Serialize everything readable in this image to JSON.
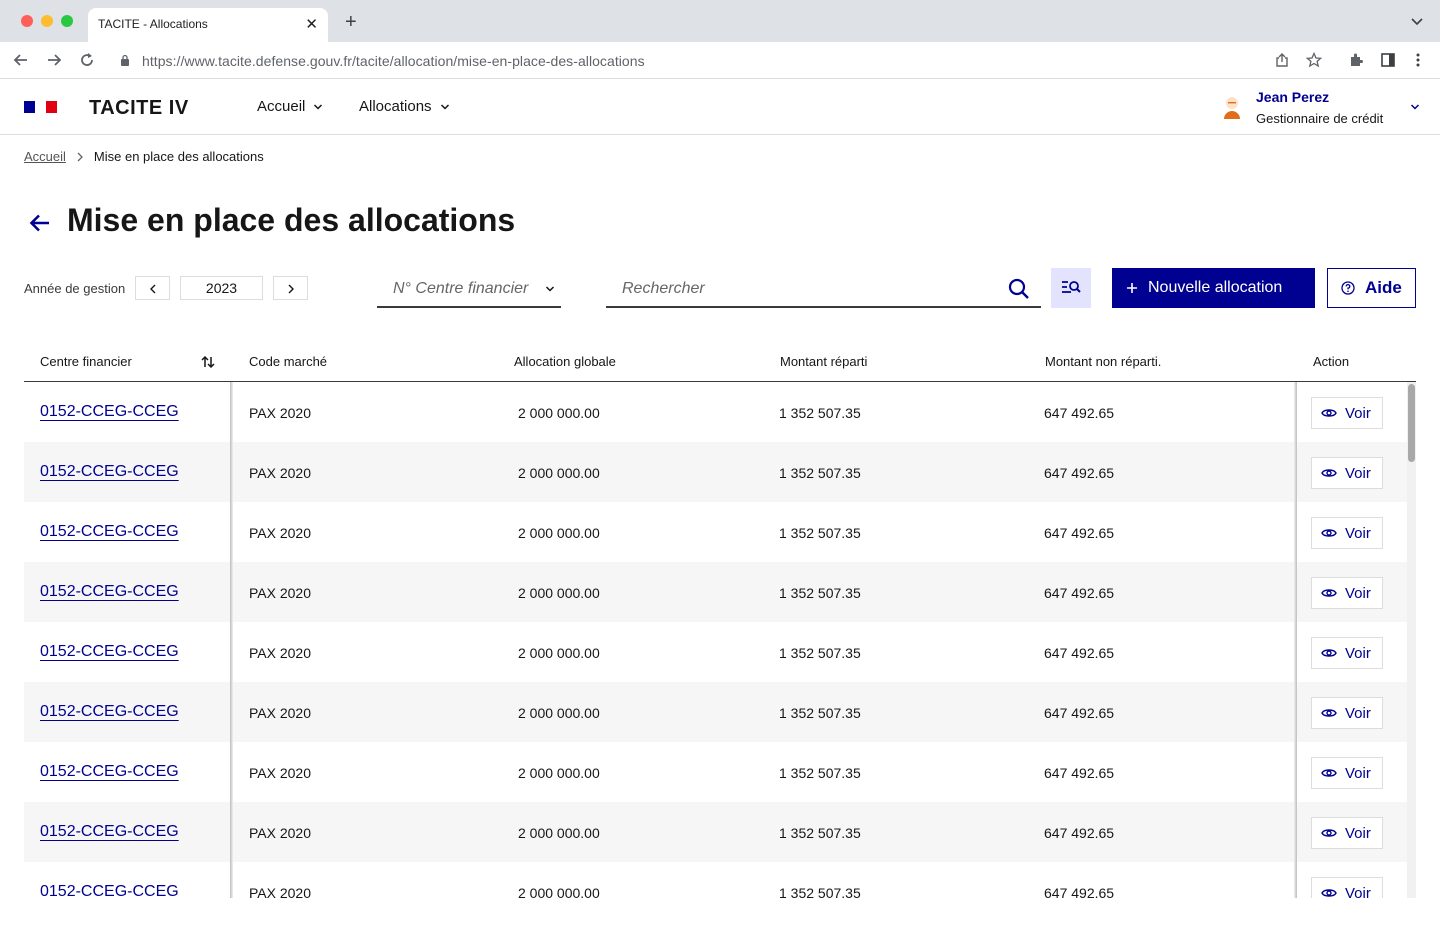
{
  "browser": {
    "tab_title": "TACITE - Allocations",
    "url": "https://www.tacite.defense.gouv.fr/tacite/allocation/mise-en-place-des-allocations"
  },
  "header": {
    "brand": "TACITE IV",
    "menu": [
      {
        "label": "Accueil"
      },
      {
        "label": "Allocations"
      }
    ],
    "user": {
      "name": "Jean Perez",
      "role": "Gestionnaire de crédit"
    }
  },
  "breadcrumb": {
    "home": "Accueil",
    "current": "Mise en place des allocations"
  },
  "page": {
    "title": "Mise en place des allocations"
  },
  "toolbar": {
    "year_label": "Année de gestion",
    "year_value": "2023",
    "centre_placeholder": "N° Centre financier",
    "search_placeholder": "Rechercher",
    "new_button": "Nouvelle allocation",
    "help_button": "Aide"
  },
  "table": {
    "columns": [
      "Centre financier",
      "Code marché",
      "Allocation globale",
      "Montant réparti",
      "Montant non réparti.",
      "Action"
    ],
    "action_label": "Voir",
    "rows": [
      {
        "centre": "0152-CCEG-CCEG",
        "code": "PAX 2020",
        "globale": "2 000 000.00",
        "reparti": "1 352 507.35",
        "non_reparti": "647 492.65"
      },
      {
        "centre": "0152-CCEG-CCEG",
        "code": "PAX 2020",
        "globale": "2 000 000.00",
        "reparti": "1 352 507.35",
        "non_reparti": "647 492.65"
      },
      {
        "centre": "0152-CCEG-CCEG",
        "code": "PAX 2020",
        "globale": "2 000 000.00",
        "reparti": "1 352 507.35",
        "non_reparti": "647 492.65"
      },
      {
        "centre": "0152-CCEG-CCEG",
        "code": "PAX 2020",
        "globale": "2 000 000.00",
        "reparti": "1 352 507.35",
        "non_reparti": "647 492.65"
      },
      {
        "centre": "0152-CCEG-CCEG",
        "code": "PAX 2020",
        "globale": "2 000 000.00",
        "reparti": "1 352 507.35",
        "non_reparti": "647 492.65"
      },
      {
        "centre": "0152-CCEG-CCEG",
        "code": "PAX 2020",
        "globale": "2 000 000.00",
        "reparti": "1 352 507.35",
        "non_reparti": "647 492.65"
      },
      {
        "centre": "0152-CCEG-CCEG",
        "code": "PAX 2020",
        "globale": "2 000 000.00",
        "reparti": "1 352 507.35",
        "non_reparti": "647 492.65"
      },
      {
        "centre": "0152-CCEG-CCEG",
        "code": "PAX 2020",
        "globale": "2 000 000.00",
        "reparti": "1 352 507.35",
        "non_reparti": "647 492.65"
      },
      {
        "centre": "0152-CCEG-CCEG",
        "code": "PAX 2020",
        "globale": "2 000 000.00",
        "reparti": "1 352 507.35",
        "non_reparti": "647 492.65"
      }
    ]
  },
  "colors": {
    "primary": "#000091",
    "flag_blue": "#000091",
    "flag_red": "#e1000f",
    "row_alt": "#f6f6f6"
  },
  "icons": [
    "back-arrow-icon",
    "search-icon",
    "advanced-search-icon",
    "plus-icon",
    "help-circle-icon",
    "eye-icon",
    "sort-icon",
    "chevron-down-icon"
  ]
}
